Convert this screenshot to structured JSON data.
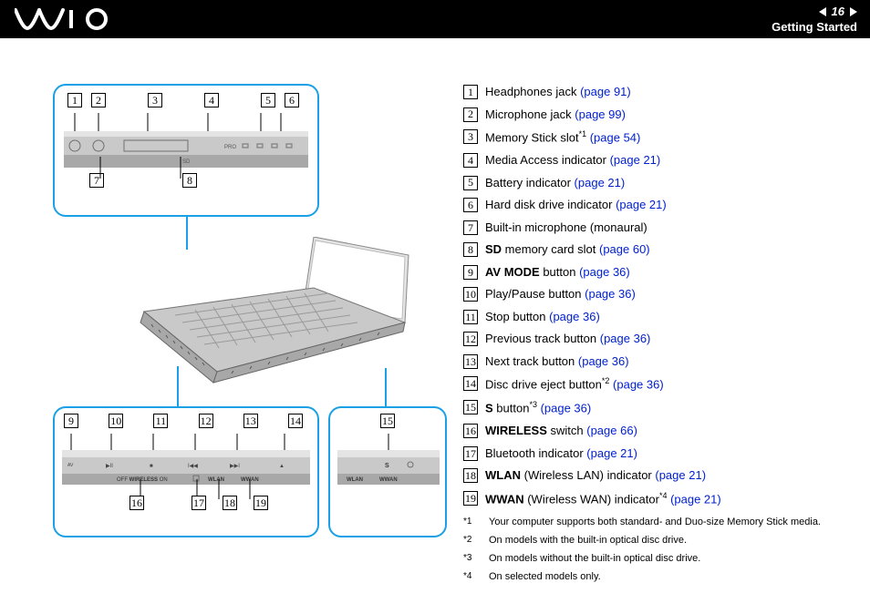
{
  "header": {
    "logo_alt": "VAIO",
    "page_number": "16",
    "section": "Getting Started"
  },
  "diagram": {
    "top_callouts": [
      "1",
      "2",
      "3",
      "4",
      "5",
      "6"
    ],
    "top_callouts_row2": [
      "7",
      "8"
    ],
    "bl_callouts_top": [
      "9",
      "10",
      "11",
      "12",
      "13",
      "14"
    ],
    "bl_callouts_bot": [
      "16",
      "17",
      "18",
      "19"
    ],
    "br_callout": "15",
    "front_labels": {
      "off": "OFF",
      "wireless": "WIRELESS",
      "on": "ON",
      "wlan": "WLAN",
      "wwan": "WWAN",
      "pro": "PRO",
      "sd": "SD",
      "s": "S",
      "av_mode": "AV MODE"
    }
  },
  "items": [
    {
      "n": "1",
      "pre": "Headphones jack ",
      "link": "(page 91)"
    },
    {
      "n": "2",
      "pre": "Microphone jack ",
      "link": "(page 99)"
    },
    {
      "n": "3",
      "pre": "Memory Stick slot",
      "sup": "*1",
      "link": " (page 54)"
    },
    {
      "n": "4",
      "pre": "Media Access indicator ",
      "link": "(page 21)"
    },
    {
      "n": "5",
      "pre": "Battery indicator ",
      "link": "(page 21)"
    },
    {
      "n": "6",
      "pre": "Hard disk drive indicator ",
      "link": "(page 21)"
    },
    {
      "n": "7",
      "pre": "Built-in microphone (monaural)"
    },
    {
      "n": "8",
      "bold": "SD",
      "post": " memory card slot ",
      "link": "(page 60)"
    },
    {
      "n": "9",
      "bold": "AV MODE",
      "post": " button ",
      "link": "(page 36)"
    },
    {
      "n": "10",
      "pre": "Play/Pause button ",
      "link": "(page 36)"
    },
    {
      "n": "11",
      "pre": "Stop button ",
      "link": "(page 36)"
    },
    {
      "n": "12",
      "pre": "Previous track button ",
      "link": "(page 36)"
    },
    {
      "n": "13",
      "pre": "Next track button ",
      "link": "(page 36)"
    },
    {
      "n": "14",
      "pre": "Disc drive eject button",
      "sup": "*2",
      "link": " (page 36)"
    },
    {
      "n": "15",
      "bold": "S",
      "post": " button",
      "sup": "*3",
      "link": " (page 36)"
    },
    {
      "n": "16",
      "bold": "WIRELESS",
      "post": " switch ",
      "link": "(page 66)"
    },
    {
      "n": "17",
      "pre": "Bluetooth indicator ",
      "link": "(page 21)"
    },
    {
      "n": "18",
      "bold": "WLAN",
      "post": " (Wireless LAN) indicator ",
      "link": "(page 21)"
    },
    {
      "n": "19",
      "bold": "WWAN",
      "post": " (Wireless WAN) indicator",
      "sup": "*4",
      "link": " (page 21)"
    }
  ],
  "footnotes": [
    {
      "mark": "*1",
      "text": "Your computer supports both standard- and Duo-size Memory Stick media."
    },
    {
      "mark": "*2",
      "text": "On models with the built-in optical disc drive."
    },
    {
      "mark": "*3",
      "text": "On models without the built-in optical disc drive."
    },
    {
      "mark": "*4",
      "text": "On selected models only."
    }
  ]
}
